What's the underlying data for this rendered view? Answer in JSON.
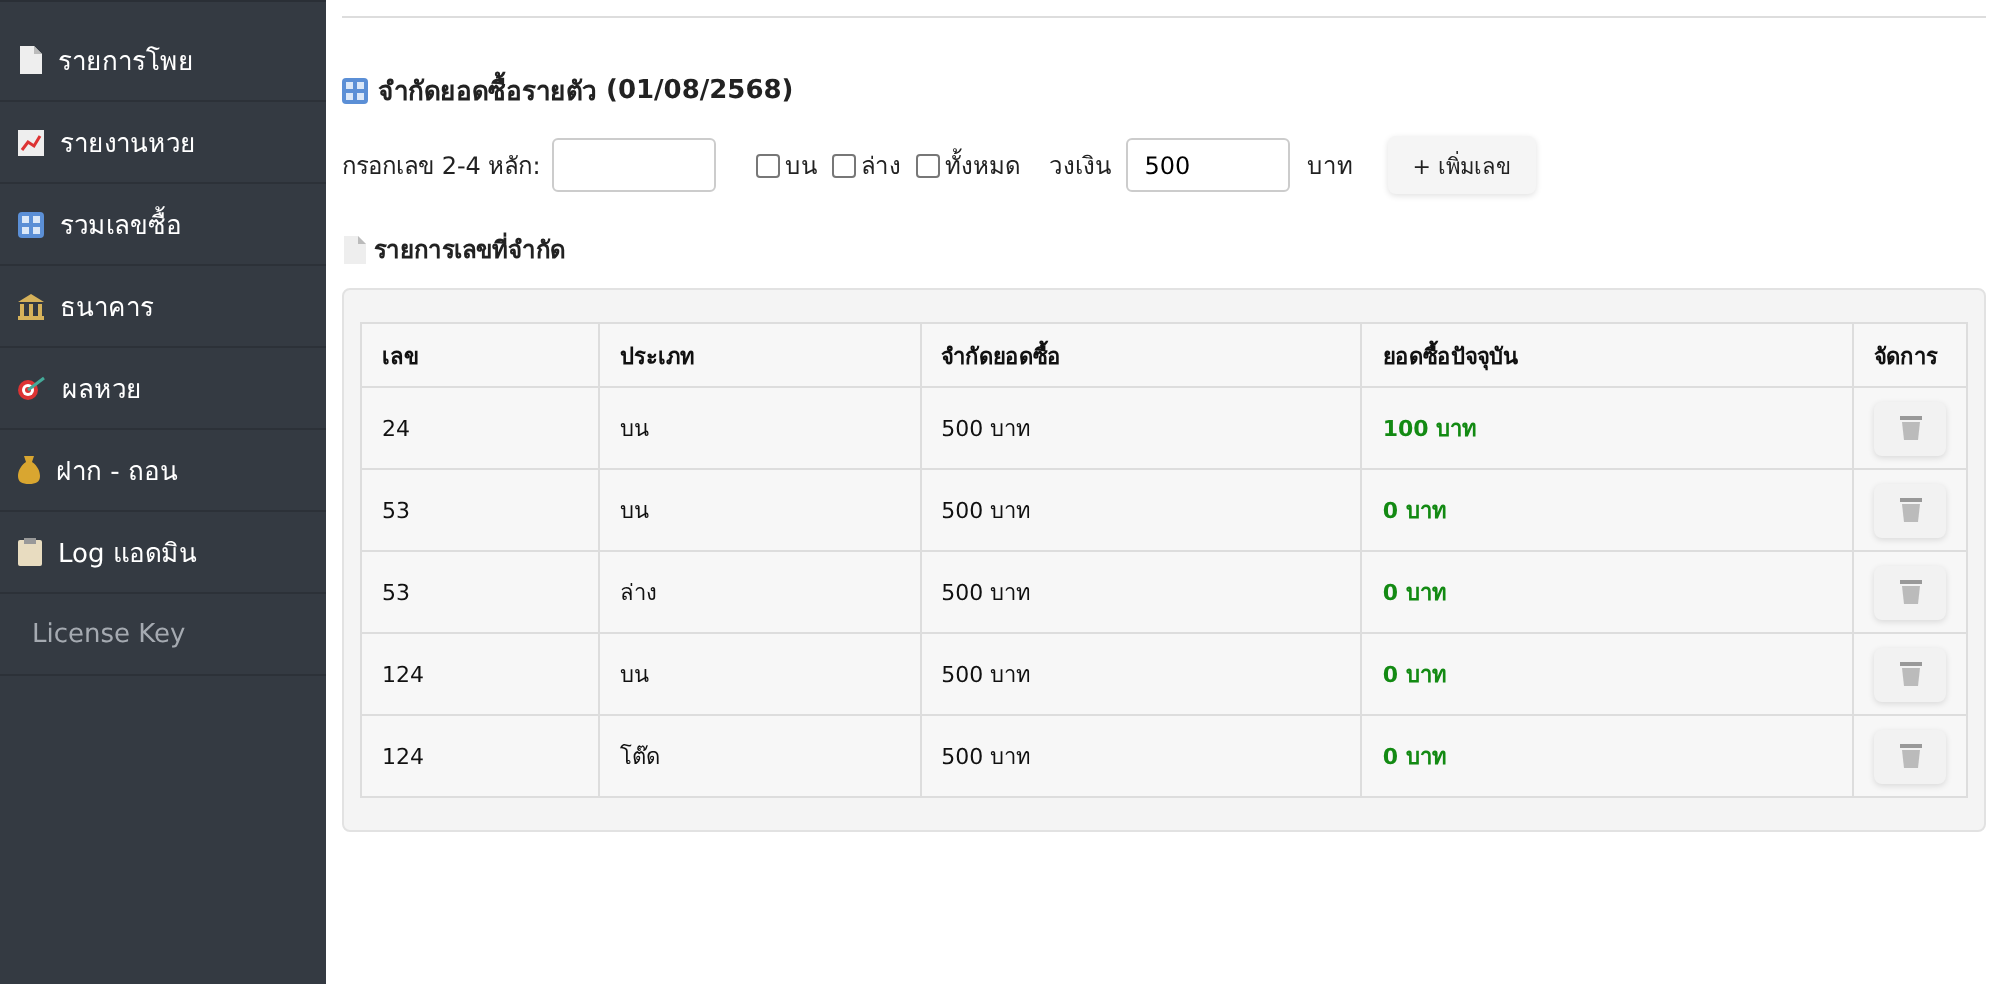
{
  "sidebar": {
    "items": [
      {
        "label": "รายการโพย",
        "kind": "link"
      },
      {
        "label": "รายงานหวย",
        "kind": "link"
      },
      {
        "label": "รวมเลขซื้อ",
        "kind": "link"
      },
      {
        "label": "ธนาคาร",
        "kind": "link"
      },
      {
        "label": "ผลหวย",
        "kind": "link"
      },
      {
        "label": "ฝาก - ถอน",
        "kind": "link"
      },
      {
        "label": "Log แอดมิน",
        "kind": "link"
      },
      {
        "label": "License Key",
        "kind": "plain"
      }
    ]
  },
  "title": "จำกัดยอดซื้อรายตัว",
  "date": "(01/08/2568)",
  "form": {
    "number_label": "กรอกเลข 2-4 หลัก:",
    "options": [
      {
        "label": "บน",
        "checked": false
      },
      {
        "label": "ล่าง",
        "checked": false
      },
      {
        "label": "ทั้งหมด",
        "checked": false
      }
    ],
    "amount_label": "วงเงิน",
    "amount_value": "500",
    "unit": "บาท",
    "add_button": "+ เพิ่มเลข"
  },
  "list_title": "รายการเลขที่จำกัด",
  "table": {
    "columns": [
      "เลข",
      "ประเภท",
      "จำกัดยอดซื้อ",
      "ยอดซื้อปัจจุบัน",
      "จัดการ"
    ],
    "rows": [
      {
        "number": "24",
        "type": "บน",
        "limit": "500 บาท",
        "current": "100 บาท"
      },
      {
        "number": "53",
        "type": "บน",
        "limit": "500 บาท",
        "current": "0 บาท"
      },
      {
        "number": "53",
        "type": "ล่าง",
        "limit": "500 บาท",
        "current": "0 บาท"
      },
      {
        "number": "124",
        "type": "บน",
        "limit": "500 บาท",
        "current": "0 บาท"
      },
      {
        "number": "124",
        "type": "โต๊ด",
        "limit": "500 บาท",
        "current": "0 บาท"
      }
    ]
  }
}
